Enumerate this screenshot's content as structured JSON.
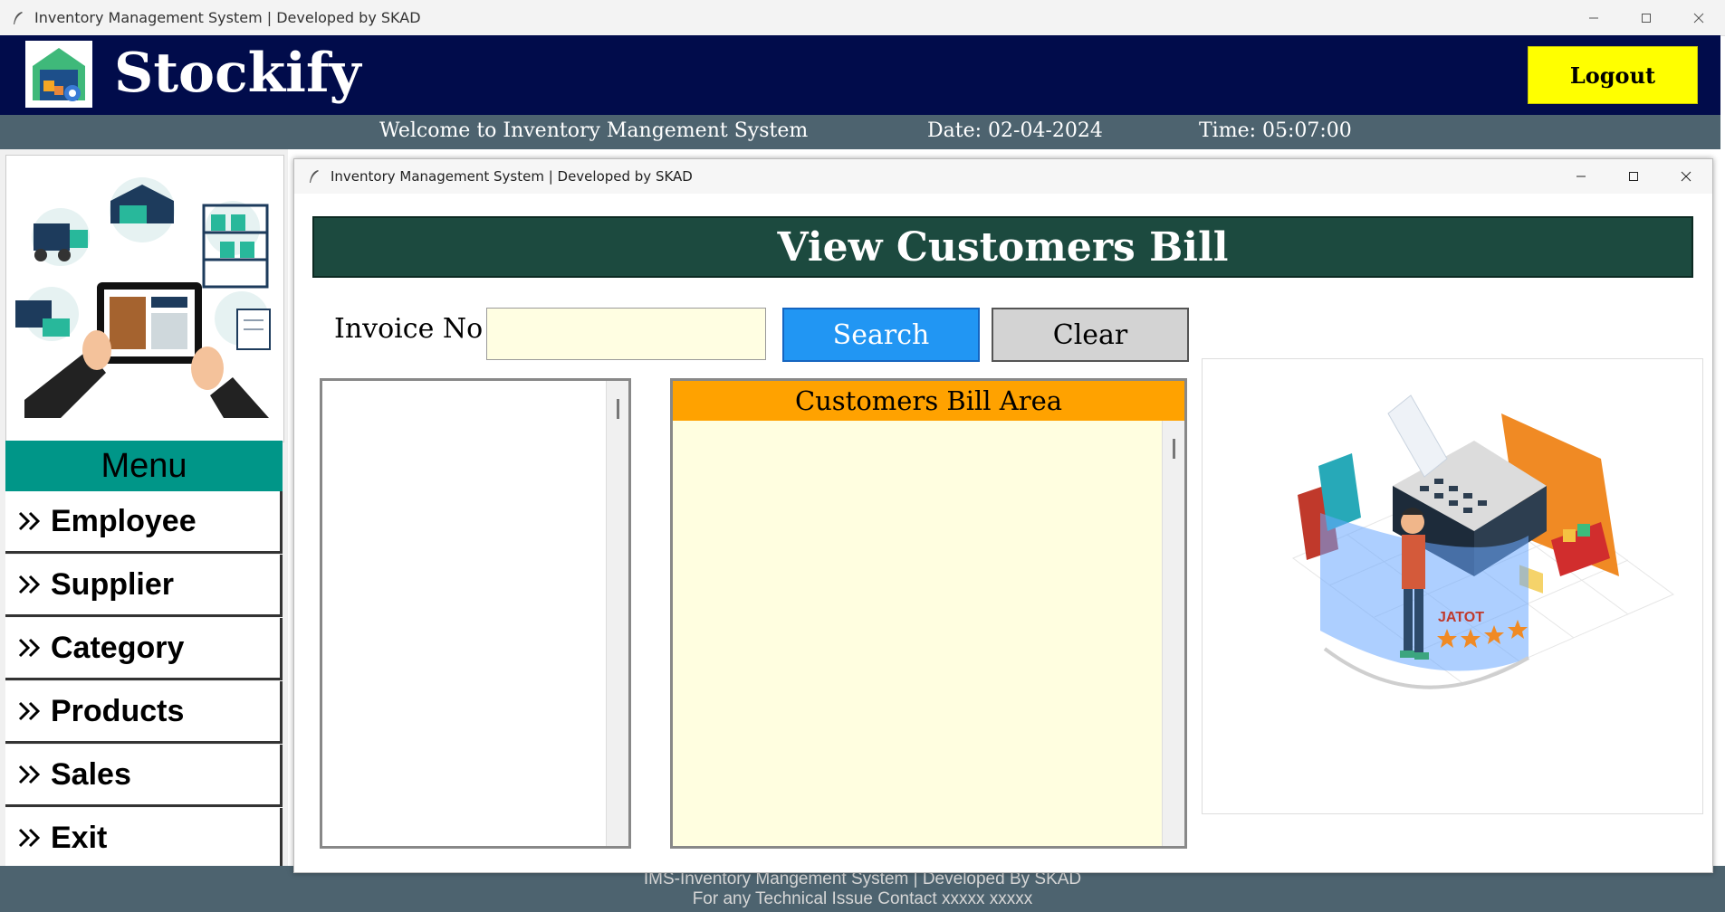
{
  "os_window": {
    "title": "Inventory Management System | Developed by SKAD"
  },
  "header": {
    "app_name": "Stockify",
    "logout_label": "Logout"
  },
  "info_strip": {
    "welcome": "Welcome to Inventory Mangement System",
    "date": "Date: 02-04-2024",
    "time": "Time: 05:07:00"
  },
  "menu": {
    "heading": "Menu",
    "items": [
      {
        "label": "Employee"
      },
      {
        "label": "Supplier"
      },
      {
        "label": "Category"
      },
      {
        "label": "Products"
      },
      {
        "label": "Sales"
      },
      {
        "label": "Exit"
      }
    ]
  },
  "child_window": {
    "title": "Inventory Management System | Developed by SKAD",
    "page_title": "View Customers Bill",
    "invoice_label": "Invoice No",
    "invoice_value": "",
    "search_label": "Search",
    "clear_label": "Clear",
    "bill_area_heading": "Customers Bill Area",
    "illustration_text": "JATOT"
  },
  "footer": {
    "line1": "IMS-Inventory Mangement System | Developed By SKAD",
    "line2": "For any Technical Issue Contact xxxxx xxxxx"
  },
  "colors": {
    "header_bg": "#010c4b",
    "strip_bg": "#4d636f",
    "menu_heading_bg": "#009688",
    "banner_bg": "#1c4a3f",
    "logout_bg": "#ffff00",
    "search_bg": "#2196f3",
    "bill_heading_bg": "#ffa200",
    "input_bg": "#fffee2"
  }
}
